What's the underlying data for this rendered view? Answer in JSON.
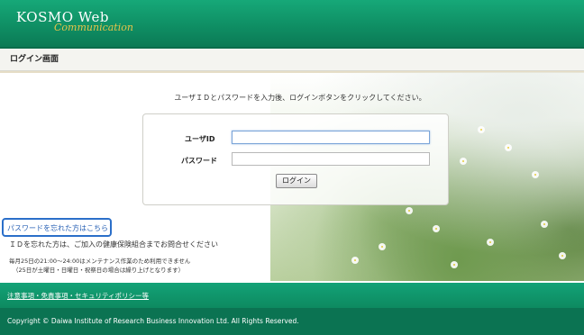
{
  "header": {
    "logo_line1": "KOSMO Web",
    "logo_line2": "Communication"
  },
  "page_title": "ログイン画面",
  "instruction": "ユーザＩＤとパスワードを入力後、ログインボタンをクリックしてください。",
  "form": {
    "userid_label": "ユーザID",
    "userid_value": "",
    "password_label": "パスワード",
    "password_value": "",
    "login_button": "ログイン"
  },
  "forgot_password_link": "パスワードを忘れた方はこちら",
  "forgot_id_note": "ＩＤを忘れた方は、ご加入の健康保険組合までお問合せください",
  "maintenance_note_1": "毎月25日の21:00～24:00はメンテナンス作業のため利用できません",
  "maintenance_note_2": "（25日が土曜日・日曜日・祝祭日の場合は繰り上げとなります）",
  "footer": {
    "links": "注意事項・免責事項・セキュリティポリシー等",
    "copyright": "Copyright © Daiwa Institute of Research Business Innovation Ltd. All Rights Reserved."
  },
  "colors": {
    "header_green": "#0f8f64",
    "footer_green": "#0b7352",
    "link_blue": "#2a62b5",
    "highlight_border": "#2b6fc9"
  }
}
